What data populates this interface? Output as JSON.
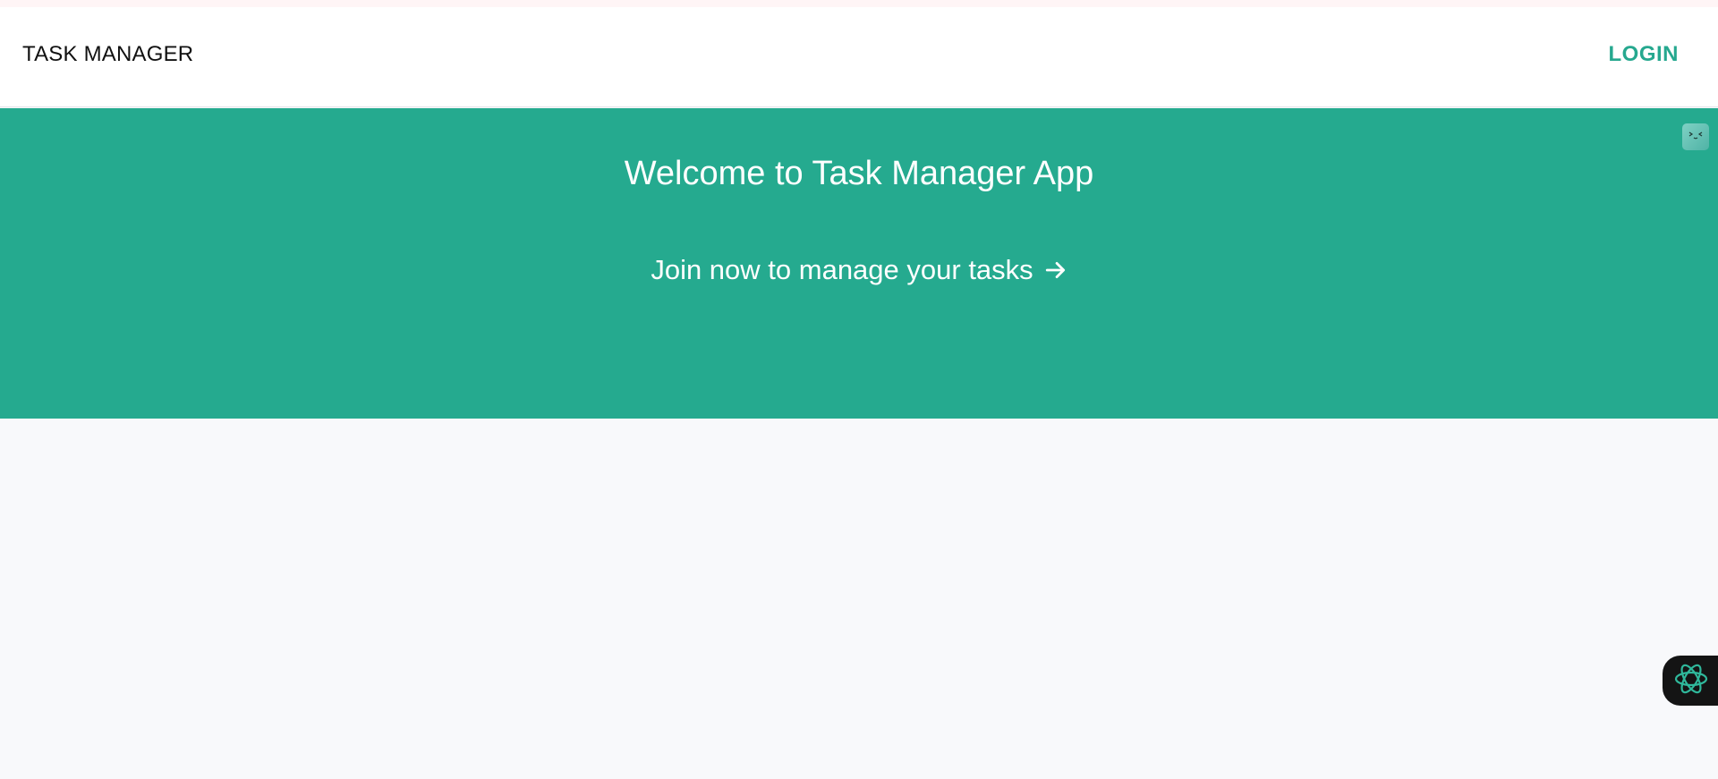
{
  "navbar": {
    "brand": "TASK MANAGER",
    "login_label": "LOGIN"
  },
  "hero": {
    "title": "Welcome to Task Manager App",
    "cta_label": "Join now to manage your tasks"
  },
  "icons": {
    "cta_arrow": "arrow-right-icon",
    "extension_widget": "face-icon",
    "assistant": "atom-icon"
  },
  "colors": {
    "accent": "#25aa8f",
    "login_text": "#26a88f",
    "page_background": "#f8f9fb",
    "navbar_background": "#ffffff"
  }
}
